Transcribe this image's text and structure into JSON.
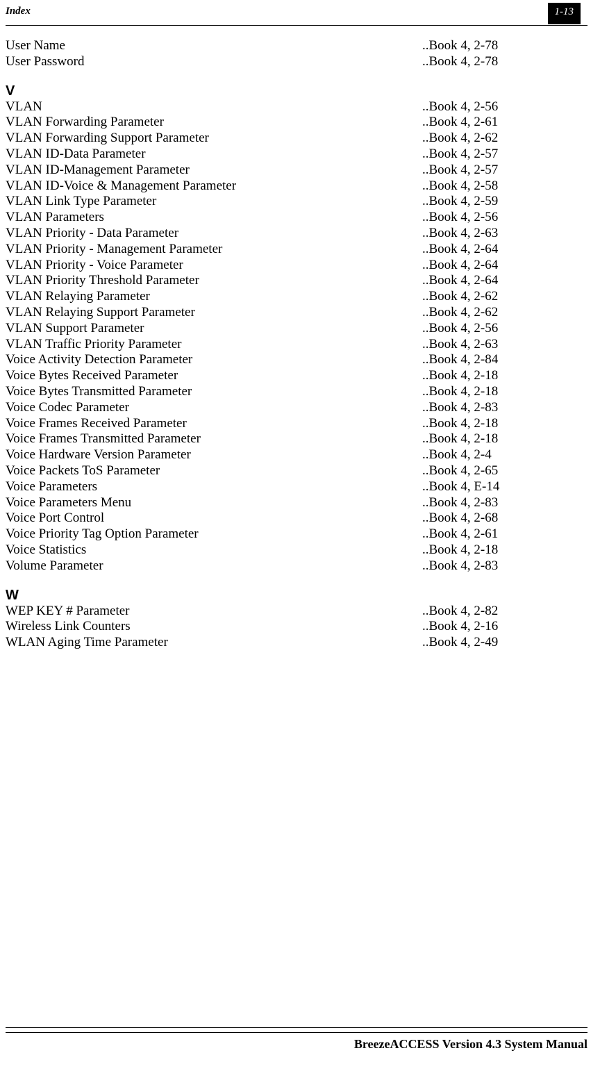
{
  "header": {
    "section_label": "Index",
    "page_badge": "1-13"
  },
  "pre_entries": [
    {
      "t": "User Name",
      "r": "..Book 4, 2-78"
    },
    {
      "t": "User Password",
      "r": "..Book 4, 2-78"
    }
  ],
  "sections": [
    {
      "letter": "V",
      "entries": [
        {
          "t": "VLAN",
          "r": "..Book 4, 2-56"
        },
        {
          "t": "VLAN Forwarding Parameter",
          "r": "..Book 4, 2-61"
        },
        {
          "t": "VLAN Forwarding Support Parameter",
          "r": "..Book 4, 2-62"
        },
        {
          "t": "VLAN ID-Data Parameter",
          "r": "..Book 4, 2-57"
        },
        {
          "t": "VLAN ID-Management Parameter",
          "r": "..Book 4, 2-57"
        },
        {
          "t": "VLAN ID-Voice & Management Parameter",
          "r": "..Book 4, 2-58"
        },
        {
          "t": "VLAN Link Type Parameter",
          "r": "..Book 4, 2-59"
        },
        {
          "t": "VLAN Parameters",
          "r": "..Book 4, 2-56"
        },
        {
          "t": "VLAN Priority - Data Parameter",
          "r": "..Book 4, 2-63"
        },
        {
          "t": "VLAN Priority - Management Parameter",
          "r": "..Book 4, 2-64"
        },
        {
          "t": "VLAN Priority - Voice Parameter",
          "r": "..Book 4, 2-64"
        },
        {
          "t": "VLAN Priority Threshold Parameter",
          "r": "..Book 4, 2-64"
        },
        {
          "t": "VLAN Relaying Parameter",
          "r": "..Book 4, 2-62"
        },
        {
          "t": "VLAN Relaying Support Parameter",
          "r": "..Book 4, 2-62"
        },
        {
          "t": "VLAN Support Parameter",
          "r": "..Book 4, 2-56"
        },
        {
          "t": "VLAN Traffic Priority Parameter",
          "r": "..Book 4, 2-63"
        },
        {
          "t": "Voice Activity Detection Parameter",
          "r": "..Book 4, 2-84"
        },
        {
          "t": "Voice Bytes Received Parameter",
          "r": "..Book 4, 2-18"
        },
        {
          "t": "Voice Bytes Transmitted Parameter",
          "r": "..Book 4, 2-18"
        },
        {
          "t": "Voice Codec Parameter",
          "r": "..Book 4, 2-83"
        },
        {
          "t": "Voice Frames Received Parameter",
          "r": "..Book 4, 2-18"
        },
        {
          "t": "Voice Frames Transmitted Parameter",
          "r": "..Book 4, 2-18"
        },
        {
          "t": "Voice Hardware Version Parameter",
          "r": "..Book 4, 2-4"
        },
        {
          "t": "Voice Packets ToS Parameter",
          "r": "..Book 4, 2-65"
        },
        {
          "t": "Voice Parameters",
          "r": "..Book 4, E-14"
        },
        {
          "t": "Voice Parameters Menu",
          "r": "..Book 4, 2-83"
        },
        {
          "t": "Voice Port Control",
          "r": "..Book 4, 2-68"
        },
        {
          "t": "Voice Priority Tag Option Parameter",
          "r": "..Book 4, 2-61"
        },
        {
          "t": "Voice Statistics",
          "r": "..Book 4, 2-18"
        },
        {
          "t": "Volume Parameter",
          "r": "..Book 4, 2-83"
        }
      ]
    },
    {
      "letter": "W",
      "entries": [
        {
          "t": "WEP KEY # Parameter",
          "r": "..Book 4, 2-82"
        },
        {
          "t": "Wireless Link Counters",
          "r": "..Book 4, 2-16"
        },
        {
          "t": "WLAN Aging Time Parameter",
          "r": "..Book 4, 2-49"
        }
      ]
    }
  ],
  "footer": {
    "manual_title": "BreezeACCESS Version 4.3 System Manual"
  }
}
